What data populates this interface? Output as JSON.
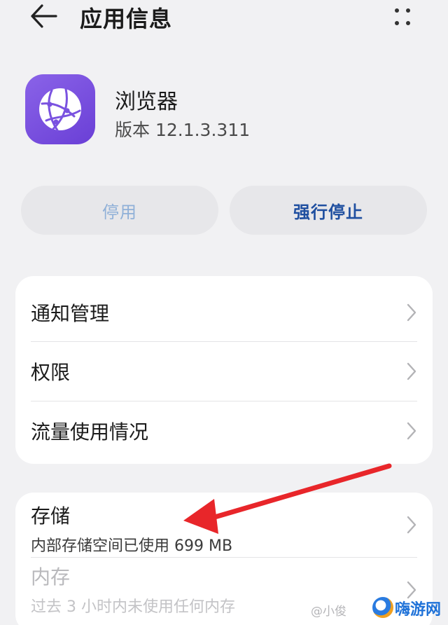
{
  "header": {
    "title": "应用信息",
    "back_icon": "arrow-left-icon",
    "more_icon": "more-dots-icon"
  },
  "app": {
    "name": "浏览器",
    "version": "版本 12.1.3.311",
    "icon": "browser-globe-icon",
    "icon_color": "#7a52e0"
  },
  "actions": {
    "disable_label": "停用",
    "force_stop_label": "强行停止",
    "disable_color": "#8fb0d8",
    "force_stop_color": "#1f4fa0"
  },
  "settings": [
    {
      "label": "通知管理"
    },
    {
      "label": "权限"
    },
    {
      "label": "流量使用情况"
    }
  ],
  "storage": {
    "title": "存储",
    "subtitle": "内部存储空间已使用 699 MB"
  },
  "memory": {
    "title": "内存",
    "subtitle": "过去 3 小时内未使用任何内存"
  },
  "annotation": {
    "arrow_color": "#e8262a"
  },
  "watermark": {
    "small_text": "@小俊",
    "brand_text": "嗨游网"
  }
}
